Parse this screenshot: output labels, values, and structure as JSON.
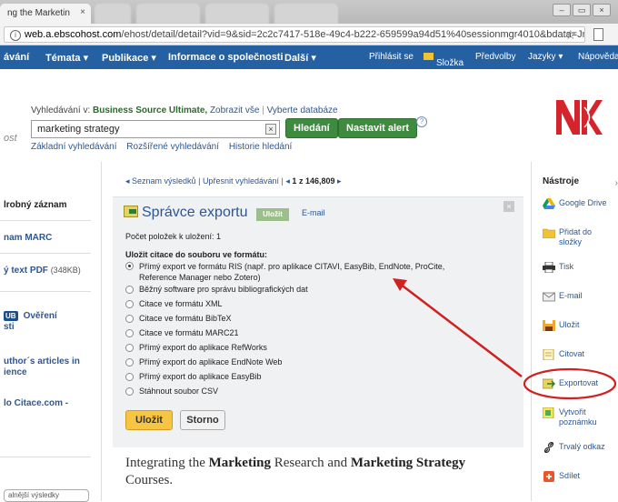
{
  "browser": {
    "active_tab_title": "ng the Marketin",
    "active_tab_close": "×",
    "url_host": "web.a.ebscohost.com",
    "url_path": "/ehost/detail/detail?vid=9&sid=2c2c7417-518e-49c4-b222-659599a94d51%40sessionmgr4010&bdata=Jmx...",
    "info_icon": "info-icon",
    "star_icon": "star-icon",
    "win_minimize": "–",
    "win_restore": "▭",
    "win_close": "×"
  },
  "nav": {
    "items": [
      "ávání",
      "Témata ▾",
      "Publikace ▾",
      "Informace o společnosti",
      "Další ▾"
    ],
    "right": [
      "Přihlásit se",
      "Složka",
      "Předvolby",
      "Jazyky ▾",
      "Nápověda"
    ]
  },
  "search": {
    "search_in_label": "Vyhledávání v:",
    "database": "Business Source Ultimate,",
    "show_all": "Zobrazit vše",
    "choose_db": "Vyberte databáze",
    "query": "marketing strategy",
    "clear": "×",
    "search_button": "Hledání",
    "alert_button": "Nastavit alert",
    "help": "?",
    "basic": "Základní vyhledávání",
    "advanced": "Rozšířené vyhledávání",
    "history": "Historie hledání",
    "left_fragment": "ost"
  },
  "logo": {
    "text": "NK"
  },
  "left": {
    "detailed": "lrobný záznam",
    "marc": "nam MARC",
    "pdf": "ý text PDF",
    "pdf_size": "(348KB)",
    "ulib_badge": "UB",
    "verify": "Ověření",
    "verify2": "sti",
    "author": "uthor´s articles in",
    "author2": "ience",
    "citace": "lo Citace.com -",
    "bottom": "alnější výsledky"
  },
  "center": {
    "back_to_results": "◂ Seznam výsledků",
    "refine": "Upřesnit vyhledávání",
    "prev": "◂",
    "position_num": "1",
    "position_of": "z 146,809",
    "next": "▸",
    "panel_title": "Správce exportu",
    "tab_save": "Uložit",
    "tab_email": "E-mail",
    "close": "×",
    "count_label": "Počet položek k uložení: 1",
    "save_label": "Uložit citace do souboru ve formátu:",
    "options": [
      "Přímý export ve formátu RIS (např. pro aplikace CITAVI, EasyBib, EndNote, ProCite, Reference Manager nebo Zotero)",
      "Běžný software pro správu bibliografických dat",
      "Citace ve formátu XML",
      "Citace ve formátu BibTeX",
      "Citace ve formátu MARC21",
      "Přímý export do aplikace RefWorks",
      "Přímý export do aplikace EndNote Web",
      "Přímý export do aplikace EasyBib",
      "Stáhnout soubor CSV"
    ],
    "selected_option_index": 0,
    "save_button": "Uložit",
    "cancel_button": "Storno",
    "article_title_1": "Integrating the",
    "article_title_2": "Marketing",
    "article_title_3": "Research and",
    "article_title_4": "Marketing Strategy",
    "article_title_5": "Courses."
  },
  "tools": {
    "heading": "Nástroje",
    "items": [
      "Google Drive",
      "Přidat do složky",
      "Tisk",
      "E-mail",
      "Uložit",
      "Citovat",
      "Exportovat",
      "Vytvořit poznámku",
      "Trvalý odkaz",
      "Sdílet"
    ],
    "icons": [
      "google-drive-icon",
      "folder-icon",
      "printer-icon",
      "email-icon",
      "save-icon",
      "cite-icon",
      "export-icon",
      "note-icon",
      "link-icon",
      "share-icon"
    ]
  },
  "annotation": {
    "color": "#d02020"
  },
  "colors": {
    "nav_bg": "#2560a3",
    "link": "#2b5797",
    "green_button": "#3e8a3e",
    "yellow_button": "#f6c544",
    "panel_bg": "#eff1f2"
  }
}
